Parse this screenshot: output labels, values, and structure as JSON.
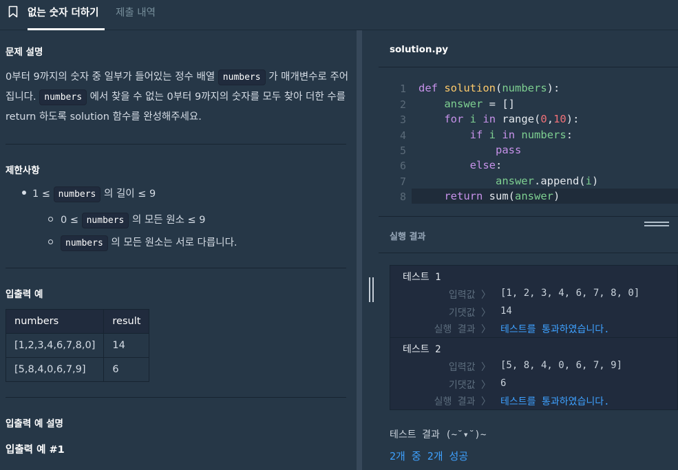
{
  "tabs": {
    "description": "없는 숫자 더하기",
    "history": "제출 내역"
  },
  "problem": {
    "heading": "문제 설명",
    "desc": {
      "p1": "0부터 9까지의 숫자 중 일부가 들어있는 정수 배열 ",
      "code1": "numbers",
      "p2": " 가 매개변수로 주어집니다. ",
      "code2": "numbers",
      "p3": " 에서 찾을 수 없는 0부터 9까지의 숫자를 모두 찾아 더한 수를 return 하도록 solution 함수를 완성해주세요."
    }
  },
  "constraints": {
    "heading": "제한사항",
    "item1": {
      "pre": "1 ≤ ",
      "code": "numbers",
      "post": " 의 길이 ≤ 9"
    },
    "item2": {
      "pre": "0 ≤ ",
      "code": "numbers",
      "post": " 의 모든 원소 ≤ 9"
    },
    "item3": {
      "code": "numbers",
      "post": " 의 모든 원소는 서로 다릅니다."
    }
  },
  "examples": {
    "heading": "입출력 예",
    "columns": [
      "numbers",
      "result"
    ],
    "rows": [
      [
        "[1,2,3,4,6,7,8,0]",
        "14"
      ],
      [
        "[5,8,4,0,6,7,9]",
        "6"
      ]
    ]
  },
  "example_explain": {
    "heading": "입출력 예 설명",
    "sub": "입출력 예 #1"
  },
  "editor": {
    "file_name": "solution.py",
    "line_numbers": [
      "1",
      "2",
      "3",
      "4",
      "5",
      "6",
      "7",
      "8"
    ],
    "tokens": {
      "def": "def",
      "solution": "solution",
      "paren_open": "(",
      "numbers": "numbers",
      "paren_close_colon": "):",
      "answer": "answer",
      "assign_list": " = []",
      "for": "for",
      "i": "i",
      "in": "in",
      "range": "range",
      "zero": "0",
      "comma": ",",
      "ten": "10",
      "if": "if",
      "pass": "pass",
      "else": "else",
      "colon": ":",
      "append": ".append(",
      "close": ")",
      "return": "return",
      "sum": "sum"
    }
  },
  "results": {
    "title": "실행 결과",
    "tests": [
      {
        "name": "테스트 1",
        "input_label": "입력값 〉",
        "input": "[1, 2, 3, 4, 6, 7, 8, 0]",
        "expected_label": "기댓값 〉",
        "expected": "14",
        "result_label": "실행 결과 〉",
        "result": "테스트를 통과하였습니다."
      },
      {
        "name": "테스트 2",
        "input_label": "입력값 〉",
        "input": "[5, 8, 4, 0, 6, 7, 9]",
        "expected_label": "기댓값 〉",
        "expected": "6",
        "result_label": "실행 결과 〉",
        "result": "테스트를 통과하였습니다."
      }
    ],
    "summary": "테스트 결과 (~˘▾˘)~",
    "score": "2개 중 2개 성공"
  },
  "colors": {
    "background": "#263747",
    "code_bg": "#202b3d",
    "accent_blue": "#3ea1ff",
    "keyword": "#c792ea",
    "function": "#ffcb6b",
    "variable": "#7ed091",
    "number": "#f07178"
  }
}
